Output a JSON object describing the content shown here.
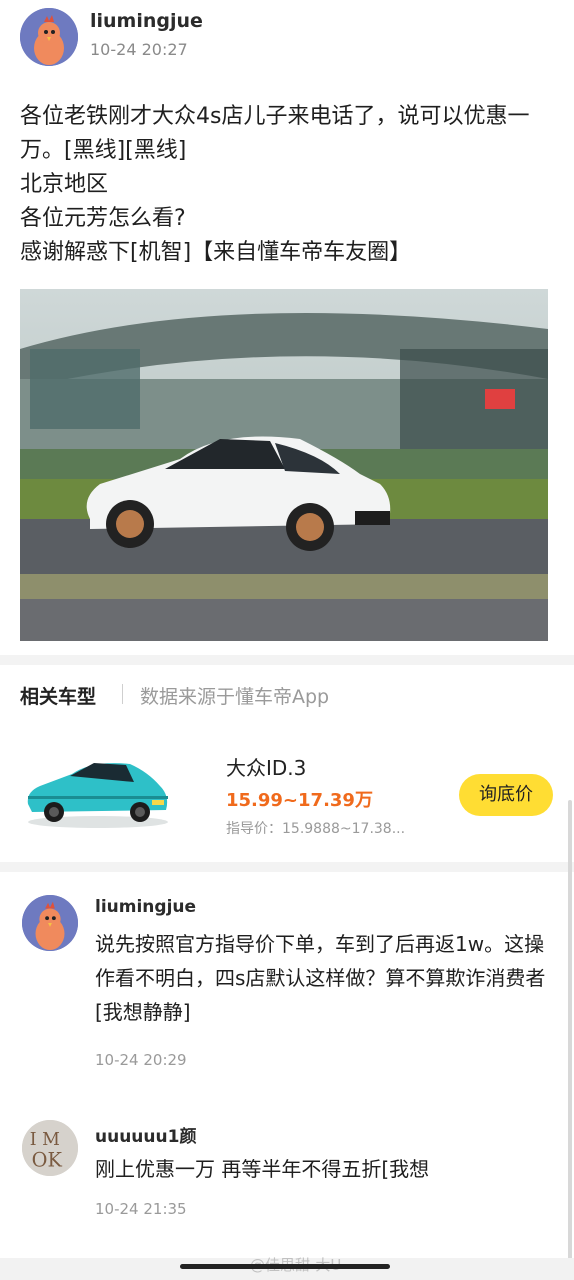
{
  "post": {
    "username": "liumingjue",
    "time": "10-24 20:27",
    "lines": [
      "各位老铁刚才大众4s店儿子来电话了，说可以优惠一万。[黑线][黑线]",
      "北京地区",
      "各位元芳怎么看?",
      "感谢解惑下[机智]【来自懂车帝车友圈】"
    ]
  },
  "related": {
    "title": "相关车型",
    "source": "数据来源于懂车帝App",
    "car": {
      "name": "大众ID.3",
      "price": "15.99~17.39万",
      "guide": "指导价：15.9888~17.38...",
      "button": "询底价"
    }
  },
  "comments": [
    {
      "username": "liumingjue",
      "text": "说先按照官方指导价下单，车到了后再返1w。这操作看不明白，四s店默认这样做？算不算欺诈消费者[我想静静]",
      "time": "10-24 20:29"
    },
    {
      "username": "uuuuuu1颜",
      "text": "刚上优惠一万 再等半年不得五折[我想",
      "time": "10-24 21:35",
      "avatar_text": "I M OK"
    }
  ],
  "watermark": "@佳思甜-大U",
  "colors": {
    "price": "#f06a1c",
    "button": "#ffdd33",
    "avatar_bg": "#6e7ac0"
  }
}
